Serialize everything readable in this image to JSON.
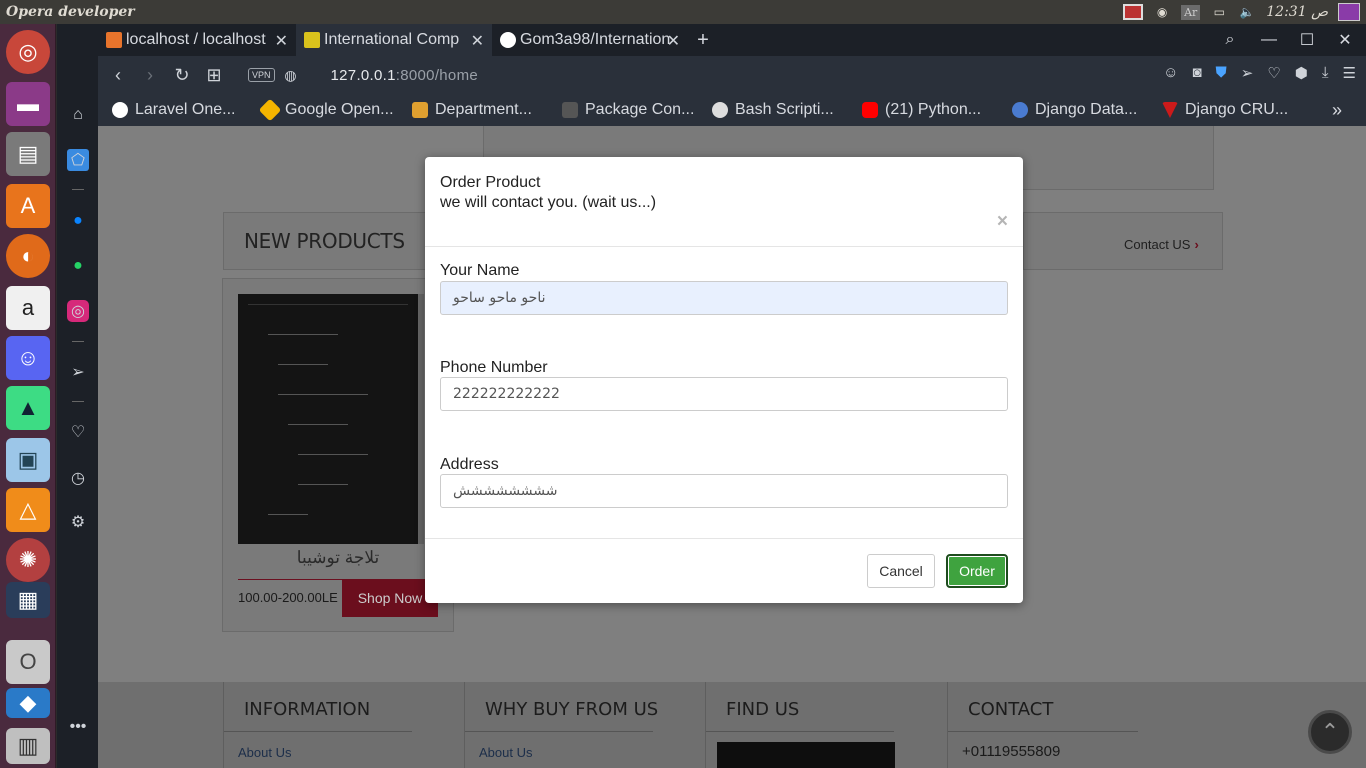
{
  "system": {
    "app_title": "Opera developer",
    "keyboard_layout": "Ar",
    "clock": "12:31 ص"
  },
  "tabs": [
    {
      "label": "localhost / localhost",
      "favicon_color": "#e8742c",
      "active": false
    },
    {
      "label": "International Comp",
      "favicon_color": "#d9c21c",
      "active": true
    },
    {
      "label": "Gom3a98/International",
      "favicon_color": "#ffffff",
      "active": false
    }
  ],
  "address": {
    "vpn": "VPN",
    "host": "127.0.0.1",
    "rest": ":8000/home"
  },
  "bookmarks": [
    {
      "label": "Laravel One...",
      "color": "#ffffff"
    },
    {
      "label": "Google Open...",
      "color": "#f4b400"
    },
    {
      "label": "Department...",
      "color": "#e0a030"
    },
    {
      "label": "Package Con...",
      "color": "#555555"
    },
    {
      "label": "Bash Scripti...",
      "color": "#dddddd"
    },
    {
      "label": "(21) Python...",
      "color": "#ff0000"
    },
    {
      "label": "Django Data...",
      "color": "#4a7bd0"
    },
    {
      "label": "Django CRU...",
      "color": "#cc1a1a"
    }
  ],
  "bookmarks_more": "»",
  "page": {
    "new_products_title": "NEW PRODUCTS",
    "contact_link": "Contact US",
    "product_name": "تلاجة توشيبا",
    "product_price": "100.00-200.00LE",
    "shop_now": "Shop Now",
    "footer": {
      "information": "INFORMATION",
      "why_buy": "WHY BUY FROM US",
      "find_us": "FIND US",
      "contact": "CONTACT",
      "about_us_1": "About Us",
      "about_us_2": "About Us",
      "phone": "+01119555809"
    }
  },
  "modal": {
    "title": "Order Product",
    "subtitle": "we will contact you. (wait us...)",
    "close": "×",
    "name_label": "Your Name",
    "name_value": "ناحو ماحو ساحو",
    "phone_label": "Phone Number",
    "phone_value": "222222222222",
    "address_label": "Address",
    "address_value": "شششششششش",
    "cancel": "Cancel",
    "order": "Order"
  }
}
